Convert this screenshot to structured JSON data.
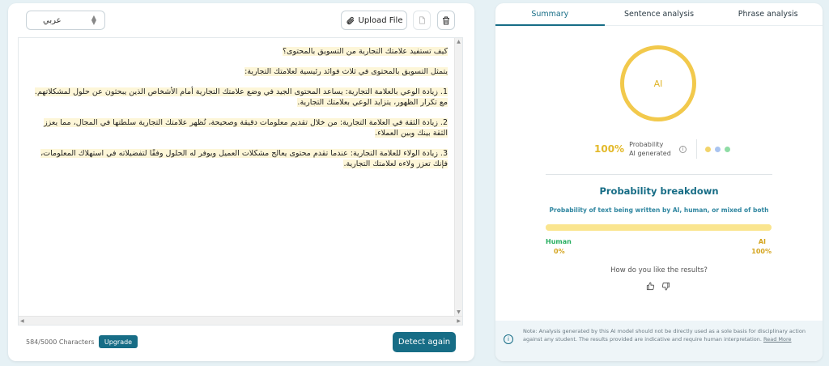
{
  "editor": {
    "language": "عربي",
    "upload_label": "Upload File",
    "paragraphs": [
      "كيف تستفيد علامتك التجارية من التسويق بالمحتوى؟",
      "يتمثل التسويق بالمحتوى في ثلاث فوائد رئيسية لعلامتك التجارية:",
      "1. زيادة الوعي بالعلامة التجارية: يساعد المحتوى الجيد في وضع علامتك التجارية أمام الأشخاص الذين يبحثون عن حلول لمشكلاتهم. مع تكرار الظهور، يتزايد الوعي بعلامتك التجارية.",
      "2. زيادة الثقة في العلامة التجارية: من خلال تقديم معلومات دقيقة وصحيحة، تُظهر علامتك التجارية سلطتها في المجال، مما يعزز الثقة بينك وبين العملاء.",
      "3. زيادة الولاء للعلامة التجارية: عندما تقدم محتوى يعالج مشكلات العميل ويوفر له الحلول وفقًا لتفضيلاته في استهلاك المعلومات، فإنك تعزز ولاءه لعلامتك التجارية."
    ],
    "char_count": "584/5000 Characters",
    "upgrade_label": "Upgrade",
    "detect_label": "Detect again"
  },
  "tabs": [
    {
      "label": "Summary",
      "active": true
    },
    {
      "label": "Sentence analysis",
      "active": false
    },
    {
      "label": "Phrase analysis",
      "active": false
    }
  ],
  "result": {
    "ring_label": "AI",
    "percent": "100%",
    "prob_line1": "Probability",
    "prob_line2": "AI generated",
    "ai_fraction": 1.0,
    "dot_colors": [
      "#f2d46b",
      "#a9c4f0",
      "#8fdca5"
    ],
    "accent": "#176d86",
    "ai_color": "#f2c94c"
  },
  "breakdown": {
    "title": "Probability breakdown",
    "subtitle": "Probability of text being written by AI, human, or mixed of both",
    "human_label": "Human",
    "human_pct": "0%",
    "ai_label": "AI",
    "ai_pct": "100%"
  },
  "feedback": {
    "question": "How do you like the results?"
  },
  "note": {
    "text": "Note: Analysis generated by this AI model should not be directly used as a sole basis for disciplinary action against any student. The results provided are indicative and require human interpretation.",
    "read_more": "Read More"
  }
}
